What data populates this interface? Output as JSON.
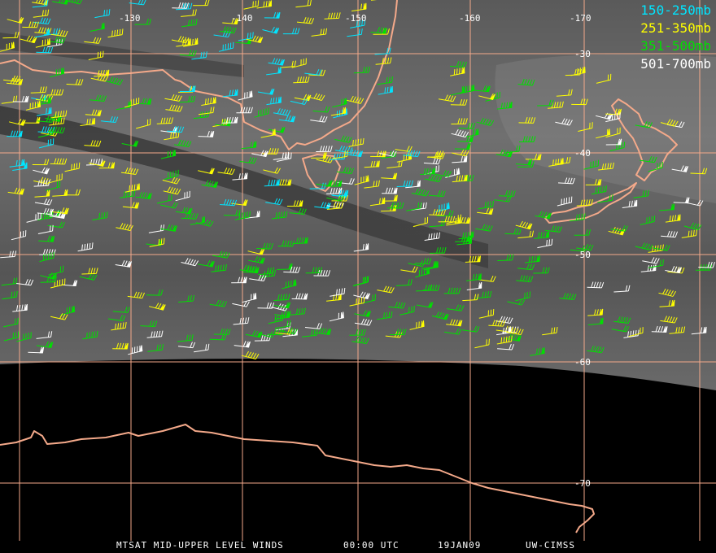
{
  "map": {
    "longitude_labels": [
      "-130",
      "-140",
      "-150",
      "-160",
      "-170"
    ],
    "latitude_labels": [
      "-30",
      "-40",
      "-50",
      "-60",
      "-70"
    ],
    "colors": {
      "coastline": "#f4a98a",
      "grid": "#f4a98a",
      "wind_150_250": "#00e5ff",
      "wind_251_350": "#ffff00",
      "wind_351_500": "#00e000",
      "wind_501_700": "#ffffff",
      "no_data": "#000000"
    }
  },
  "legend": [
    {
      "label": "150-250mb",
      "color": "#00e5ff"
    },
    {
      "label": "251-350mb",
      "color": "#ffff00"
    },
    {
      "label": "351-500mb",
      "color": "#00e000"
    },
    {
      "label": "501-700mb",
      "color": "#ffffff"
    }
  ],
  "footer": {
    "product": "MTSAT MID-UPPER LEVEL WINDS",
    "time": "00:00 UTC",
    "date": "19JAN09",
    "source": "UW-CIMSS"
  }
}
